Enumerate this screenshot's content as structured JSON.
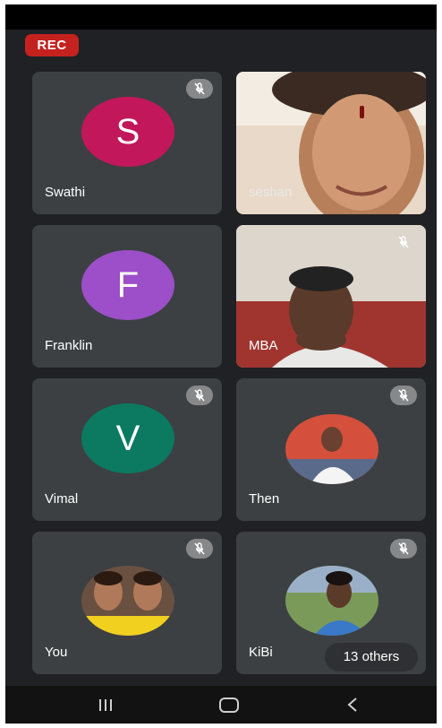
{
  "recording_badge": "REC",
  "participants": [
    {
      "name": "Swathi",
      "initial": "S",
      "color": "#c2185b",
      "muted": true
    },
    {
      "name": "seshan",
      "video": true,
      "muted": false
    },
    {
      "name": "Franklin",
      "initial": "F",
      "color": "#9c4fc8",
      "muted": false
    },
    {
      "name": "MBA",
      "video": true,
      "muted": true
    },
    {
      "name": "Vimal",
      "initial": "V",
      "color": "#0b7a61",
      "muted": true
    },
    {
      "name": "Then",
      "photo": true,
      "muted": true
    },
    {
      "name": "You",
      "photo": true,
      "muted": true
    },
    {
      "name": "KiBi",
      "photo": true,
      "muted": true
    }
  ],
  "others_chip": "13 others",
  "icons": {
    "mute": "mic-off-icon",
    "nav_recents": "recents-icon",
    "nav_home": "home-icon",
    "nav_back": "back-icon"
  }
}
